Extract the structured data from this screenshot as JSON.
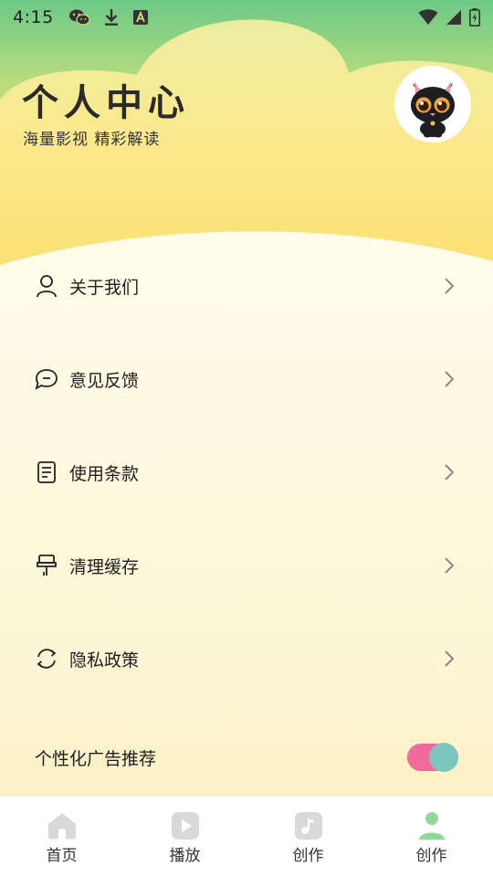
{
  "status_bar": {
    "time": "4:15",
    "left_icons": [
      "wechat-icon",
      "download-icon",
      "font-a-icon"
    ],
    "right_icons": [
      "wifi-icon",
      "signal-icon",
      "battery-charging-icon"
    ]
  },
  "header": {
    "title": "个人中心",
    "subtitle": "海量影视 精彩解读",
    "avatar_icon": "black-cat-avatar"
  },
  "menu": {
    "items": [
      {
        "label": "关于我们",
        "icon": "person-icon"
      },
      {
        "label": "意见反馈",
        "icon": "chat-bubble-icon"
      },
      {
        "label": "使用条款",
        "icon": "document-icon"
      },
      {
        "label": "清理缓存",
        "icon": "brush-icon"
      },
      {
        "label": "隐私政策",
        "icon": "refresh-icon"
      }
    ]
  },
  "ad_toggle": {
    "label": "个性化广告推荐",
    "enabled": true
  },
  "tabs": [
    {
      "label": "首页",
      "icon": "home-icon",
      "active": false
    },
    {
      "label": "播放",
      "icon": "play-icon",
      "active": false
    },
    {
      "label": "创作",
      "icon": "music-note-icon",
      "active": false
    },
    {
      "label": "创作",
      "icon": "user-icon",
      "active": true
    }
  ],
  "colors": {
    "header_green": "#6cc986",
    "header_yellow": "#fbd24f",
    "toggle_track": "#f06a9c",
    "toggle_knob": "#7dc6bf",
    "tab_inactive": "#d9d9d9",
    "tab_active": "#8fd99b"
  }
}
